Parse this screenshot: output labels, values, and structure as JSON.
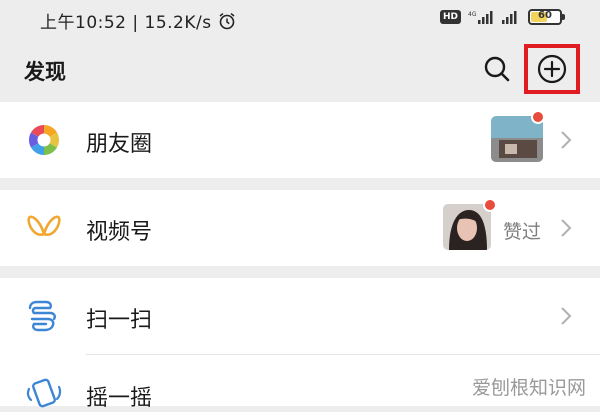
{
  "status_bar": {
    "time_network": "上午10:52 | 15.2K/s",
    "hd": "HD",
    "battery": "60",
    "battery_level_percent": 60
  },
  "header": {
    "title": "发现",
    "search_icon": "search-icon",
    "add_icon": "plus-circle-icon"
  },
  "items": [
    {
      "label": "朋友圈",
      "icon": "moments-aperture-icon",
      "has_thumbnail": true,
      "has_red_dot": true
    },
    {
      "label": "视频号",
      "icon": "channels-butterfly-icon",
      "has_thumbnail": true,
      "has_red_dot": true,
      "extra": "赞过"
    },
    {
      "label": "扫一扫",
      "icon": "scan-icon"
    },
    {
      "label": "摇一摇",
      "icon": "shake-icon"
    }
  ],
  "watermark": "爱刨根知识网",
  "colors": {
    "background": "#ededed",
    "highlight_box": "#e01b22",
    "red_dot": "#e74c3c"
  }
}
